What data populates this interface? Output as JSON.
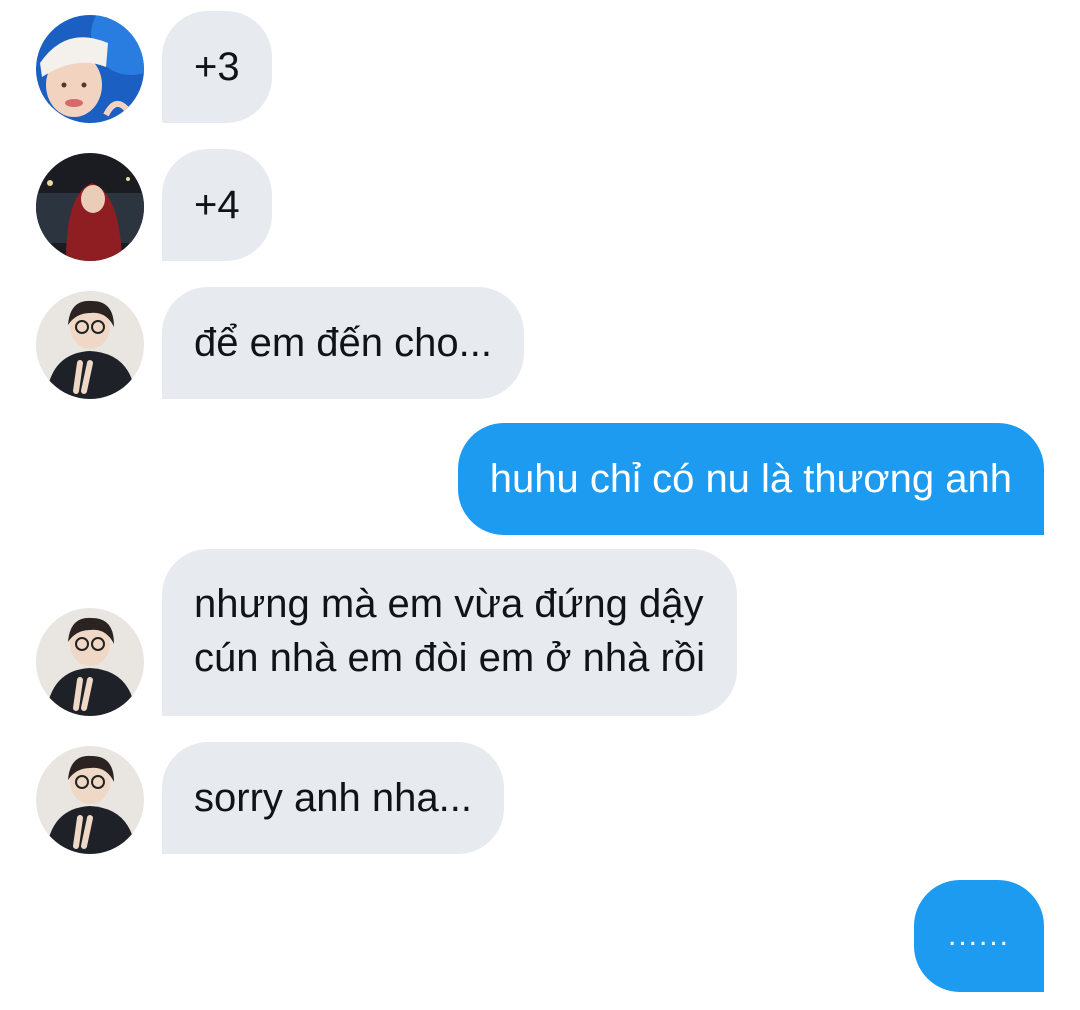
{
  "conversation": {
    "messages": [
      {
        "id": 1,
        "direction": "incoming",
        "sender": "user-1",
        "text": "+3"
      },
      {
        "id": 2,
        "direction": "incoming",
        "sender": "user-2",
        "text": "+4"
      },
      {
        "id": 3,
        "direction": "incoming",
        "sender": "user-3",
        "text": "để em đến cho..."
      },
      {
        "id": 4,
        "direction": "outgoing",
        "sender": "me",
        "text": "huhu chỉ có nu là thương anh"
      },
      {
        "id": 5,
        "direction": "incoming",
        "sender": "user-3",
        "text": "nhưng mà em vừa đứng dậy\ncún nhà em đòi em ở nhà rồi"
      },
      {
        "id": 6,
        "direction": "incoming",
        "sender": "user-3",
        "text": "sorry anh nha..."
      },
      {
        "id": 7,
        "direction": "outgoing",
        "sender": "me",
        "text": "......"
      }
    ]
  },
  "colors": {
    "incoming_bubble": "#e7eaee",
    "outgoing_bubble": "#1d9bf0",
    "incoming_text": "#0f1419",
    "outgoing_text": "#ffffff",
    "background": "#ffffff"
  },
  "icons": {
    "user-1": "avatar-santa-hat-photo",
    "user-2": "avatar-red-hood-night-photo",
    "user-3": "avatar-glasses-peace-sign-photo"
  }
}
